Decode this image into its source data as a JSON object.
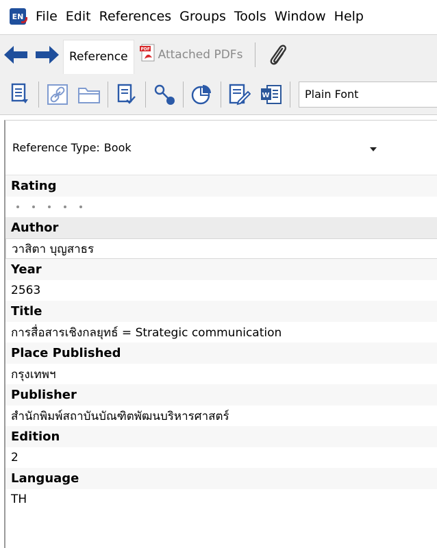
{
  "menu": {
    "logo_text": "EN",
    "items": [
      "File",
      "Edit",
      "References",
      "Groups",
      "Tools",
      "Window",
      "Help"
    ]
  },
  "tabs": {
    "reference_label": "Reference",
    "attached_pdfs_label": "Attached PDFs"
  },
  "toolbar": {
    "output_style": "Plain Font"
  },
  "reference": {
    "type_label": "Reference Type:",
    "type_value": "Book",
    "rating_label": "Rating",
    "rating_value": 0,
    "rating_max": 5,
    "fields": [
      {
        "label": "Author",
        "value": "วาสิตา บุญสาธร"
      },
      {
        "label": "Year",
        "value": "2563"
      },
      {
        "label": "Title",
        "value": "การสื่อสารเชิงกลยุทธ์ = Strategic communication"
      },
      {
        "label": "Place Published",
        "value": "กรุงเทพฯ"
      },
      {
        "label": "Publisher",
        "value": "สำนักพิมพ์สถาบันบัณฑิตพัฒนบริหารศาสตร์"
      },
      {
        "label": "Edition",
        "value": "2"
      },
      {
        "label": "Language",
        "value": "TH"
      }
    ]
  },
  "colors": {
    "nav_arrow": "#1f4f9c",
    "toolbar_icon": "#2b5aa8",
    "pdf_red": "#d8282a",
    "word_blue": "#2b579a"
  }
}
